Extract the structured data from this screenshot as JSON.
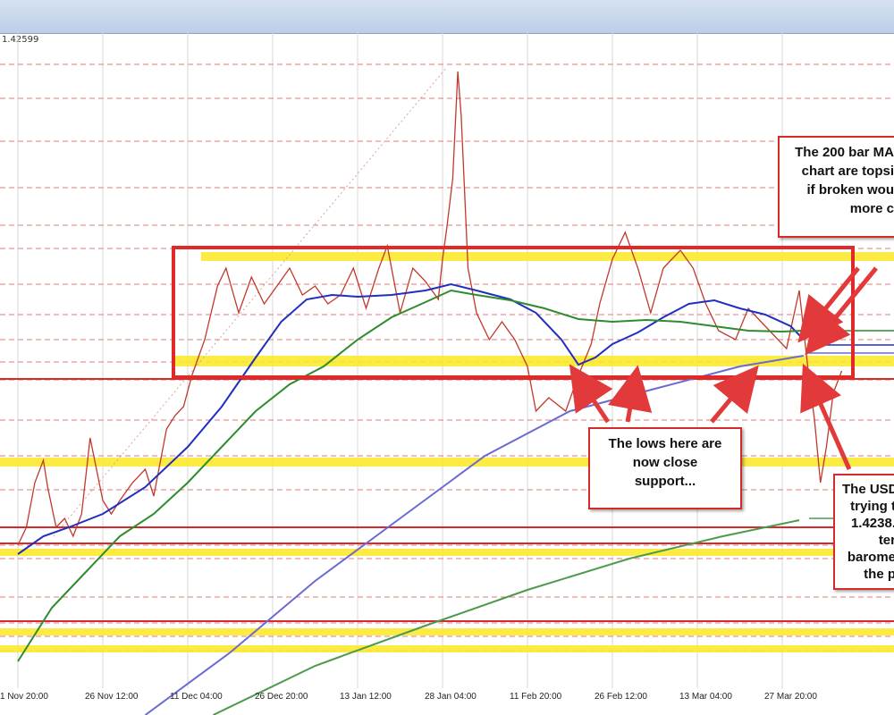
{
  "window": {
    "price_readout": "1.42599"
  },
  "chart_data": {
    "type": "line",
    "title": "",
    "xlabel": "",
    "ylabel": "",
    "x_ticks": [
      "1 Nov 20:00",
      "26 Nov 12:00",
      "11 Dec 04:00",
      "26 Dec 20:00",
      "13 Jan 12:00",
      "28 Jan 04:00",
      "11 Feb 20:00",
      "26 Feb 12:00",
      "13 Mar 04:00",
      "27 Mar 20:00"
    ],
    "grid": true,
    "series": [
      {
        "name": "",
        "color": "#c0392b",
        "points": [
          [
            0.0,
            610
          ],
          [
            0.1,
            590
          ],
          [
            0.2,
            540
          ],
          [
            0.3,
            515
          ],
          [
            0.35,
            545
          ],
          [
            0.45,
            590
          ],
          [
            0.55,
            580
          ],
          [
            0.65,
            600
          ],
          [
            0.75,
            575
          ],
          [
            0.85,
            490
          ],
          [
            1.0,
            560
          ],
          [
            1.1,
            575
          ],
          [
            1.2,
            560
          ],
          [
            1.35,
            540
          ],
          [
            1.5,
            525
          ],
          [
            1.6,
            555
          ],
          [
            1.75,
            480
          ],
          [
            1.85,
            465
          ],
          [
            1.95,
            455
          ],
          [
            2.05,
            420
          ],
          [
            2.2,
            380
          ],
          [
            2.35,
            320
          ],
          [
            2.45,
            300
          ],
          [
            2.6,
            350
          ],
          [
            2.75,
            310
          ],
          [
            2.9,
            340
          ],
          [
            3.05,
            320
          ],
          [
            3.2,
            300
          ],
          [
            3.35,
            330
          ],
          [
            3.5,
            320
          ],
          [
            3.65,
            340
          ],
          [
            3.8,
            330
          ],
          [
            3.95,
            300
          ],
          [
            4.1,
            345
          ],
          [
            4.25,
            300
          ],
          [
            4.35,
            275
          ],
          [
            4.5,
            350
          ],
          [
            4.65,
            300
          ],
          [
            4.8,
            315
          ],
          [
            4.95,
            335
          ],
          [
            5.0,
            290
          ],
          [
            5.05,
            255
          ],
          [
            5.12,
            200
          ],
          [
            5.18,
            80
          ],
          [
            5.22,
            130
          ],
          [
            5.3,
            300
          ],
          [
            5.4,
            350
          ],
          [
            5.55,
            380
          ],
          [
            5.7,
            360
          ],
          [
            5.85,
            380
          ],
          [
            6.0,
            410
          ],
          [
            6.1,
            460
          ],
          [
            6.25,
            445
          ],
          [
            6.45,
            460
          ],
          [
            6.6,
            420
          ],
          [
            6.75,
            385
          ],
          [
            6.85,
            340
          ],
          [
            7.0,
            290
          ],
          [
            7.15,
            260
          ],
          [
            7.3,
            300
          ],
          [
            7.45,
            350
          ],
          [
            7.6,
            300
          ],
          [
            7.8,
            280
          ],
          [
            7.95,
            300
          ],
          [
            8.1,
            340
          ],
          [
            8.25,
            370
          ],
          [
            8.45,
            380
          ],
          [
            8.6,
            345
          ],
          [
            8.75,
            360
          ],
          [
            8.9,
            375
          ],
          [
            9.05,
            390
          ],
          [
            9.2,
            325
          ],
          [
            9.3,
            410
          ],
          [
            9.38,
            470
          ],
          [
            9.45,
            540
          ],
          [
            9.52,
            500
          ],
          [
            9.6,
            440
          ],
          [
            9.7,
            415
          ]
        ]
      },
      {
        "name": "",
        "color": "#1f2fbf",
        "points": [
          [
            0.0,
            620
          ],
          [
            0.3,
            600
          ],
          [
            0.6,
            590
          ],
          [
            1.0,
            575
          ],
          [
            1.5,
            545
          ],
          [
            2.0,
            500
          ],
          [
            2.4,
            455
          ],
          [
            2.8,
            400
          ],
          [
            3.1,
            360
          ],
          [
            3.4,
            335
          ],
          [
            3.7,
            330
          ],
          [
            4.0,
            332
          ],
          [
            4.4,
            330
          ],
          [
            4.8,
            325
          ],
          [
            5.1,
            318
          ],
          [
            5.4,
            325
          ],
          [
            5.8,
            335
          ],
          [
            6.1,
            350
          ],
          [
            6.4,
            380
          ],
          [
            6.6,
            408
          ],
          [
            6.8,
            400
          ],
          [
            7.0,
            385
          ],
          [
            7.3,
            372
          ],
          [
            7.6,
            355
          ],
          [
            7.9,
            340
          ],
          [
            8.2,
            336
          ],
          [
            8.5,
            345
          ],
          [
            8.8,
            352
          ],
          [
            9.1,
            365
          ],
          [
            9.25,
            380
          ]
        ]
      },
      {
        "name": "",
        "color": "#2e8b2e",
        "points": [
          [
            0.0,
            740
          ],
          [
            0.4,
            680
          ],
          [
            0.8,
            640
          ],
          [
            1.2,
            600
          ],
          [
            1.6,
            575
          ],
          [
            2.0,
            540
          ],
          [
            2.4,
            500
          ],
          [
            2.8,
            460
          ],
          [
            3.2,
            430
          ],
          [
            3.6,
            410
          ],
          [
            4.0,
            380
          ],
          [
            4.4,
            355
          ],
          [
            4.8,
            338
          ],
          [
            5.1,
            325
          ],
          [
            5.4,
            330
          ],
          [
            5.8,
            336
          ],
          [
            6.2,
            345
          ],
          [
            6.6,
            357
          ],
          [
            7.0,
            360
          ],
          [
            7.4,
            358
          ],
          [
            7.8,
            360
          ],
          [
            8.2,
            365
          ],
          [
            8.6,
            370
          ],
          [
            9.0,
            371
          ],
          [
            9.25,
            370
          ]
        ]
      },
      {
        "name": "",
        "color": "#6a6ad4",
        "points": [
          [
            1.5,
            800
          ],
          [
            2.5,
            730
          ],
          [
            3.5,
            650
          ],
          [
            4.5,
            580
          ],
          [
            5.5,
            510
          ],
          [
            6.5,
            460
          ],
          [
            7.5,
            435
          ],
          [
            8.5,
            410
          ],
          [
            9.25,
            398
          ]
        ]
      },
      {
        "name": "",
        "color": "#4c9a4c",
        "points": [
          [
            2.3,
            800
          ],
          [
            3.5,
            745
          ],
          [
            4.8,
            700
          ],
          [
            6.0,
            660
          ],
          [
            7.2,
            625
          ],
          [
            8.3,
            600
          ],
          [
            9.2,
            582
          ]
        ]
      }
    ]
  },
  "annotations": [
    {
      "lines": [
        "The 200 bar MA",
        "chart are topsi",
        "if broken wou",
        "more c"
      ]
    },
    {
      "lines": [
        "The lows here are",
        "now close",
        "support..."
      ]
    },
    {
      "lines": [
        "The USD",
        "trying t",
        "1.4238.",
        "ter",
        "barome",
        "the p"
      ]
    }
  ]
}
